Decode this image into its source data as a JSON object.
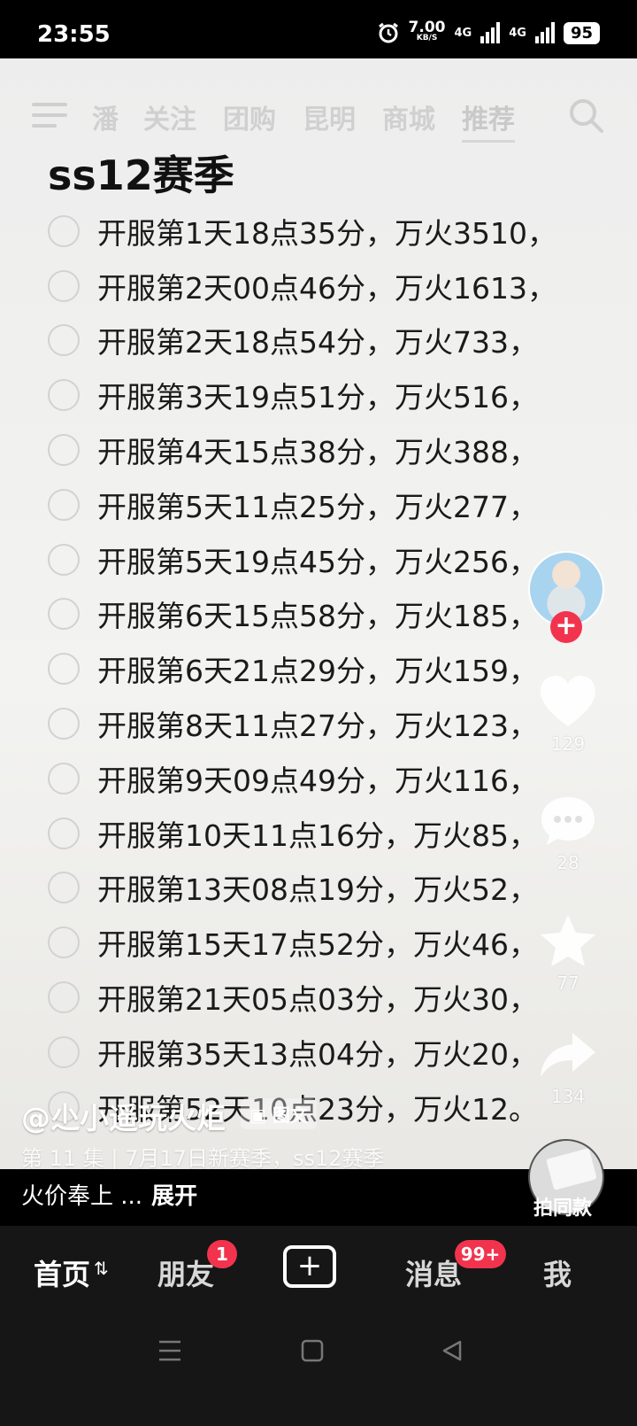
{
  "status": {
    "time": "23:55",
    "speed_value": "7.00",
    "speed_unit": "KB/S",
    "network_1": "4G",
    "network_2": "4G",
    "battery": "95"
  },
  "topnav": {
    "tabs": [
      "潘",
      "关注",
      "团购",
      "昆明",
      "商城",
      "推荐"
    ],
    "active": "推荐"
  },
  "note": {
    "title": "ss12赛季",
    "items": [
      "开服第1天18点35分，万火3510，",
      "开服第2天00点46分，万火1613，",
      "开服第2天18点54分，万火733，",
      "开服第3天19点51分，万火516，",
      "开服第4天15点38分，万火388，",
      "开服第5天11点25分，万火277，",
      "开服第5天19点45分，万火256，",
      "开服第6天15点58分，万火185，",
      "开服第6天21点29分，万火159，",
      "开服第8天11点27分，万火123，",
      "开服第9天09点49分，万火116，",
      "开服第10天11点16分，万火85，",
      "开服第13天08点19分，万火52，",
      "开服第15天17点52分，万火46，",
      "开服第21天05点03分，万火30，",
      "开服第35天13点04分，万火20，",
      "开服第52天10点23分，万火12。"
    ]
  },
  "side": {
    "like_count": "129",
    "comment_count": "28",
    "favorite_count": "77",
    "share_count": "134",
    "follow_symbol": "+"
  },
  "post": {
    "author": "@尐小遥玩火炬",
    "tag": "图文",
    "episode": "第 11 集 | 7月17日新赛季，ss12赛季",
    "caption": "火价奉上 ...",
    "expand": "展开",
    "same_style": "拍同款"
  },
  "bottom_nav": {
    "home": "首页",
    "friends": "朋友",
    "friends_badge": "1",
    "create": "+",
    "messages": "消息",
    "messages_badge": "99+",
    "me": "我"
  }
}
